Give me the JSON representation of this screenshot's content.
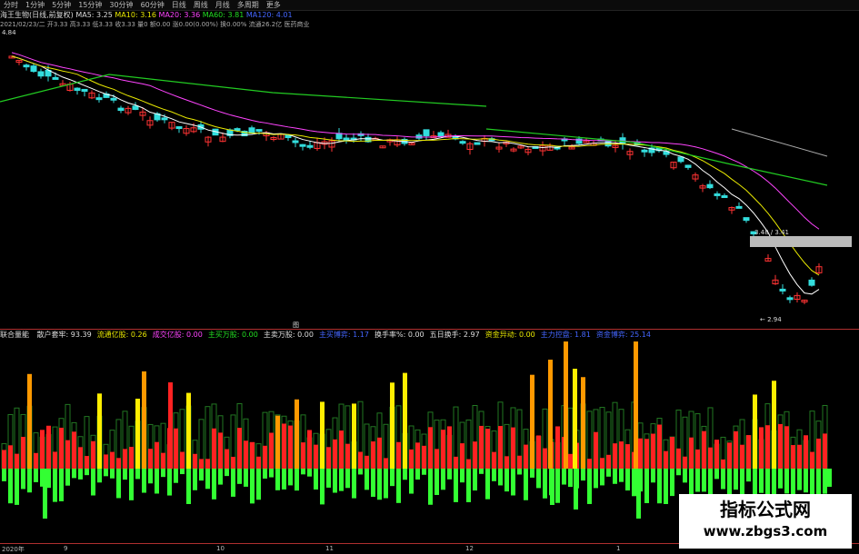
{
  "toolbar": {
    "items": [
      "分时",
      "1分钟",
      "5分钟",
      "15分钟",
      "30分钟",
      "60分钟",
      "日线",
      "周线",
      "月线",
      "多周期",
      "更多"
    ]
  },
  "stock": {
    "name": "海王生物(日线,前复权)",
    "ma_values": [
      {
        "label": "MA5:",
        "value": "3.25"
      },
      {
        "label": "MA10:",
        "value": "3.16"
      },
      {
        "label": "MA20:",
        "value": "3.36"
      },
      {
        "label": "MA60:",
        "value": "3.81"
      },
      {
        "label": "MA120:",
        "value": "4.01"
      }
    ],
    "ohlc_line": "2021/02/23/二 开3.33 高3.33 低3.33 收3.33 量0 额0.00 涨0.00(0.00%) 换0.00% 流通26.2亿 医药商业",
    "high_price_label": "4.84",
    "marker_label": "3.48 / 3.41",
    "low_price_label": "2.94",
    "bottom_tag": "图"
  },
  "indicator": {
    "items": [
      {
        "label": "联合量能",
        "value": ""
      },
      {
        "label": "散户套牢:",
        "value": "93.39"
      },
      {
        "label": "流通亿股:",
        "value": "0.26"
      },
      {
        "label": "成交亿股:",
        "value": "0.00"
      },
      {
        "label": "主买万股:",
        "value": "0.00"
      },
      {
        "label": "主卖万股:",
        "value": "0.00"
      },
      {
        "label": "主买博弈:",
        "value": "1.17"
      },
      {
        "label": "换手率%:",
        "value": "0.00"
      },
      {
        "label": "五日换手:",
        "value": "2.97"
      },
      {
        "label": "资金异动:",
        "value": "0.00"
      },
      {
        "label": "主力控盘:",
        "value": "1.81"
      },
      {
        "label": "资金博弈:",
        "value": "25.14"
      }
    ]
  },
  "dates": [
    "2020年",
    "9",
    "10",
    "11",
    "12",
    "1"
  ],
  "watermark": {
    "line1": "指标公式网",
    "line2": "www.zbgs3.com"
  },
  "colors": {
    "up": "#ff3333",
    "down": "#33dddd",
    "ma5": "#ffffff",
    "ma10": "#e8e800",
    "ma20": "#ff44ff",
    "ma60": "#22cc22",
    "ma120": "#aaaaaa",
    "vol_red": "#ff2222",
    "vol_green": "#33ff33",
    "vol_orange": "#ff9900",
    "vol_yellow": "#ffee00"
  }
}
